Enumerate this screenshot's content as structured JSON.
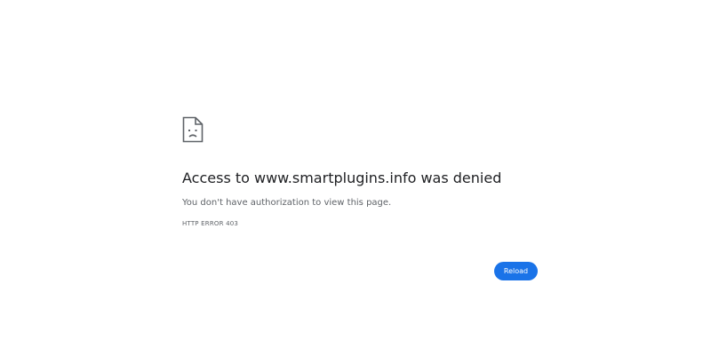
{
  "error": {
    "icon": "sad-document-icon",
    "title": "Access to www.smartplugins.info was denied",
    "message": "You don't have authorization to view this page.",
    "code": "HTTP ERROR 403"
  },
  "actions": {
    "reload_label": "Reload"
  },
  "colors": {
    "accent": "#1a73e8",
    "title_text": "#202124",
    "secondary_text": "#5f6368"
  }
}
